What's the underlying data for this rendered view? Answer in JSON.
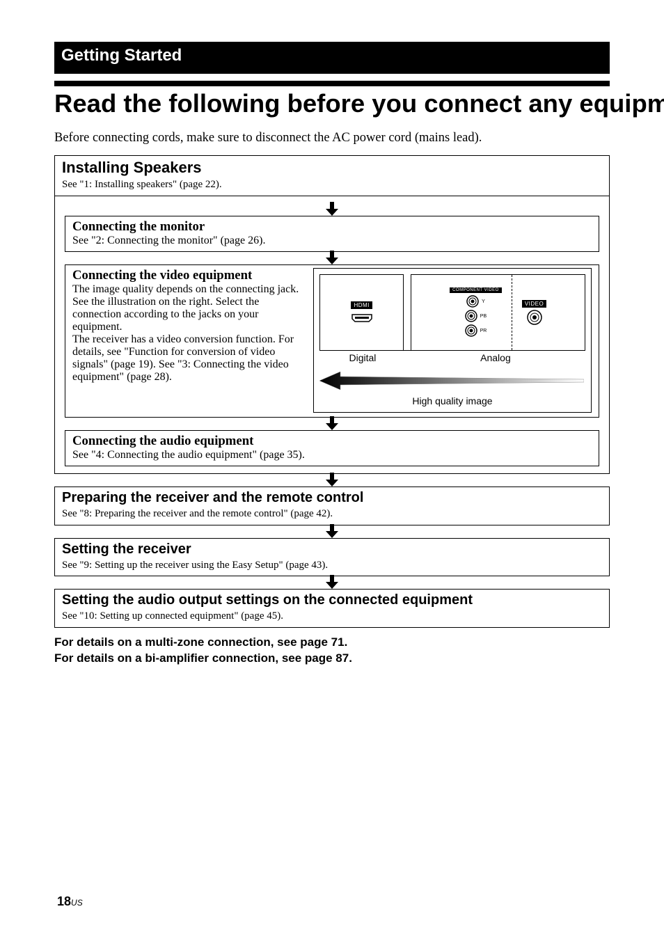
{
  "section_header": "Getting Started",
  "main_title": "Read the following before you connect any equipment",
  "intro": "Before connecting cords, make sure to disconnect the AC power cord (mains lead).",
  "box1": {
    "title": "Installing Speakers",
    "sub": "See \"1: Installing speakers\" (page 22)."
  },
  "box2": {
    "title": "Connecting the monitor",
    "sub": "See \"2: Connecting the monitor\" (page 26)."
  },
  "box3": {
    "title": "Connecting the video equipment",
    "body": "The image quality depends on the connecting jack. See the illustration on the right. Select the connection according to the jacks on your equipment.\nThe receiver has a video conversion function. For details, see \"Function for conversion of video signals\" (page 19). See \"3: Connecting the video equipment\" (page 28).",
    "hdmi": "HDMI",
    "component": "COMPONENT VIDEO",
    "video": "VIDEO",
    "y": "Y",
    "pb": "PB",
    "pr": "PR",
    "digital": "Digital",
    "analog": "Analog",
    "quality": "High quality image"
  },
  "box4": {
    "title": "Connecting the audio equipment",
    "sub": "See \"4: Connecting the audio equipment\" (page 35)."
  },
  "box5": {
    "title": "Preparing the receiver and the remote control",
    "sub": "See \"8: Preparing the receiver and the remote control\" (page 42)."
  },
  "box6": {
    "title": "Setting the receiver",
    "sub": "See \"9: Setting up the receiver using the Easy Setup\" (page 43)."
  },
  "box7": {
    "title": "Setting the audio output settings on the connected equipment",
    "sub": "See \"10: Setting up connected equipment\" (page 45)."
  },
  "footnote1": "For details on a multi-zone connection, see page 71.",
  "footnote2": "For details on a bi-amplifier connection, see page 87.",
  "page_number": "18",
  "page_suffix": "US"
}
